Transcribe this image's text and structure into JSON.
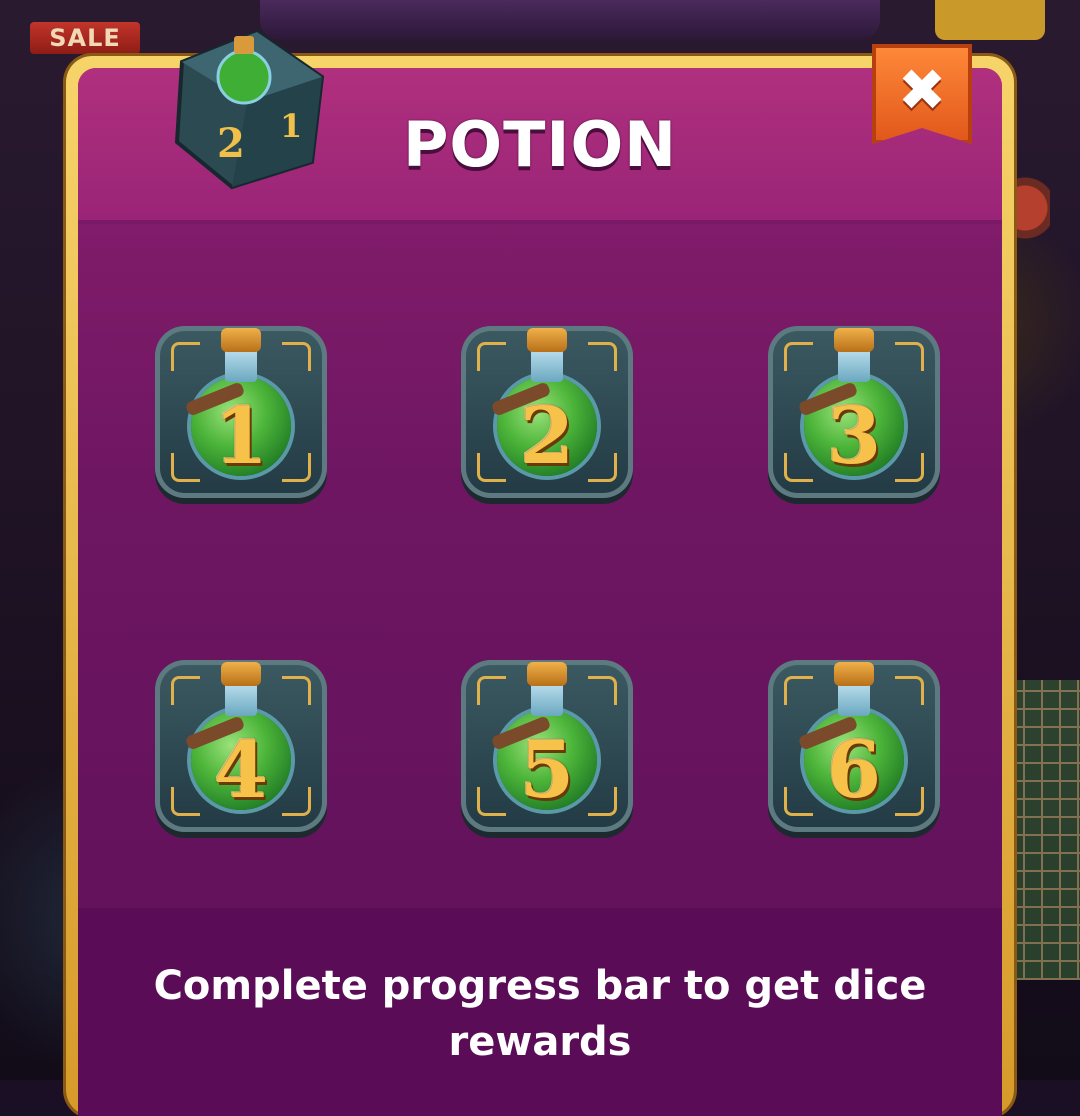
{
  "background": {
    "sale_label": "SALE"
  },
  "dialog": {
    "title": "POTION",
    "close_label": "✖",
    "tiles": [
      {
        "number": "1"
      },
      {
        "number": "2"
      },
      {
        "number": "3"
      },
      {
        "number": "4"
      },
      {
        "number": "5"
      },
      {
        "number": "6"
      }
    ],
    "footer_text": "Complete progress bar to get dice rewards"
  },
  "colors": {
    "panel_border": "#f7d46a",
    "panel_fill": "#8b1f6f",
    "close_button": "#ff8a3a",
    "number_gold": "#f6c24a"
  },
  "icons": {
    "dice": "potion-dice-icon",
    "tile": "potion-bottle-icon"
  }
}
